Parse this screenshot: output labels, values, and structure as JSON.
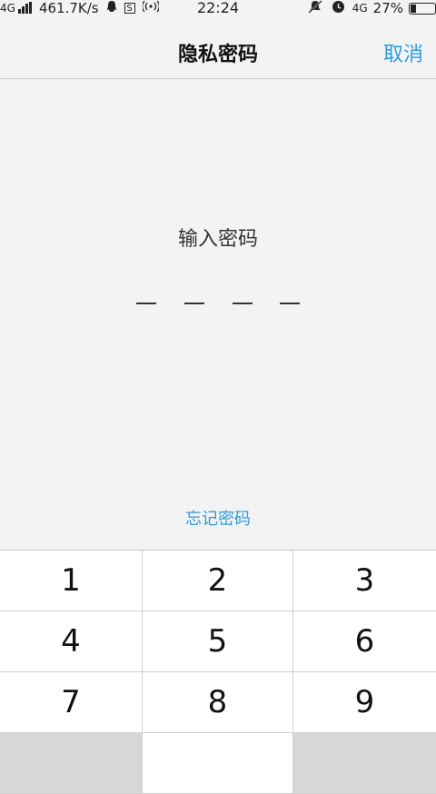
{
  "status_bar": {
    "network": "4G",
    "speed": "461.7K/s",
    "time": "22:24",
    "network_right": "4G",
    "battery": "27%",
    "battery_level": 0.27
  },
  "nav": {
    "title": "隐私密码",
    "cancel": "取消"
  },
  "prompt": "输入密码",
  "pin_slots": 4,
  "forgot_password": "忘记密码",
  "keypad": {
    "keys": [
      "1",
      "2",
      "3",
      "4",
      "5",
      "6",
      "7",
      "8",
      "9"
    ]
  },
  "colors": {
    "accent": "#2d9cdb",
    "background": "#f3f3f3"
  }
}
